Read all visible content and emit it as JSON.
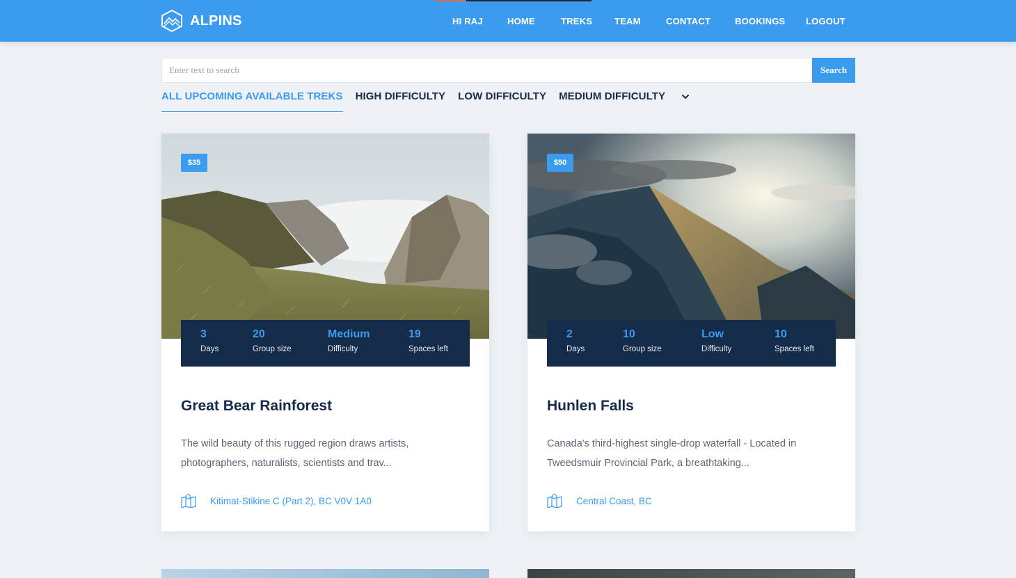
{
  "brand": {
    "name": "ALPINS"
  },
  "nav": {
    "items": [
      "HI RAJ",
      "HOME",
      "TREKS",
      "TEAM",
      "CONTACT",
      "BOOKINGS",
      "LOGOUT"
    ]
  },
  "search": {
    "placeholder": "Enter text to search",
    "value": "",
    "button": "Search"
  },
  "tabs": [
    {
      "label": "ALL UPCOMING AVAILABLE TREKS",
      "active": true
    },
    {
      "label": "HIGH DIFFICULTY",
      "active": false
    },
    {
      "label": "LOW DIFFICULTY",
      "active": false
    },
    {
      "label": "MEDIUM DIFFICULTY",
      "active": false
    }
  ],
  "cards": [
    {
      "price": "$35",
      "stats": [
        {
          "value": "3",
          "label": "Days"
        },
        {
          "value": "20",
          "label": "Group size"
        },
        {
          "value": "Medium",
          "label": "Difficulty"
        },
        {
          "value": "19",
          "label": "Spaces left"
        }
      ],
      "title": "Great Bear Rainforest",
      "description": "The wild beauty of this rugged region draws artists, photographers, naturalists, scientists and trav...",
      "location": "Kitimat-Stikine C (Part 2), BC V0V 1A0"
    },
    {
      "price": "$50",
      "stats": [
        {
          "value": "2",
          "label": "Days"
        },
        {
          "value": "10",
          "label": "Group size"
        },
        {
          "value": "Low",
          "label": "Difficulty"
        },
        {
          "value": "10",
          "label": "Spaces left"
        }
      ],
      "title": "Hunlen Falls",
      "description": "Canada's third-highest single-drop waterfall - Located in Tweedsmuir Provincial Park, a breathtaking...",
      "location": "Central Coast, BC"
    }
  ],
  "colors": {
    "primary": "#3a9bef",
    "navy": "#142b49",
    "background": "#eef2f6"
  },
  "icons": {
    "logo": "mountain-hexagon-icon",
    "location": "map-icon",
    "dropdown": "chevron-down-icon"
  }
}
